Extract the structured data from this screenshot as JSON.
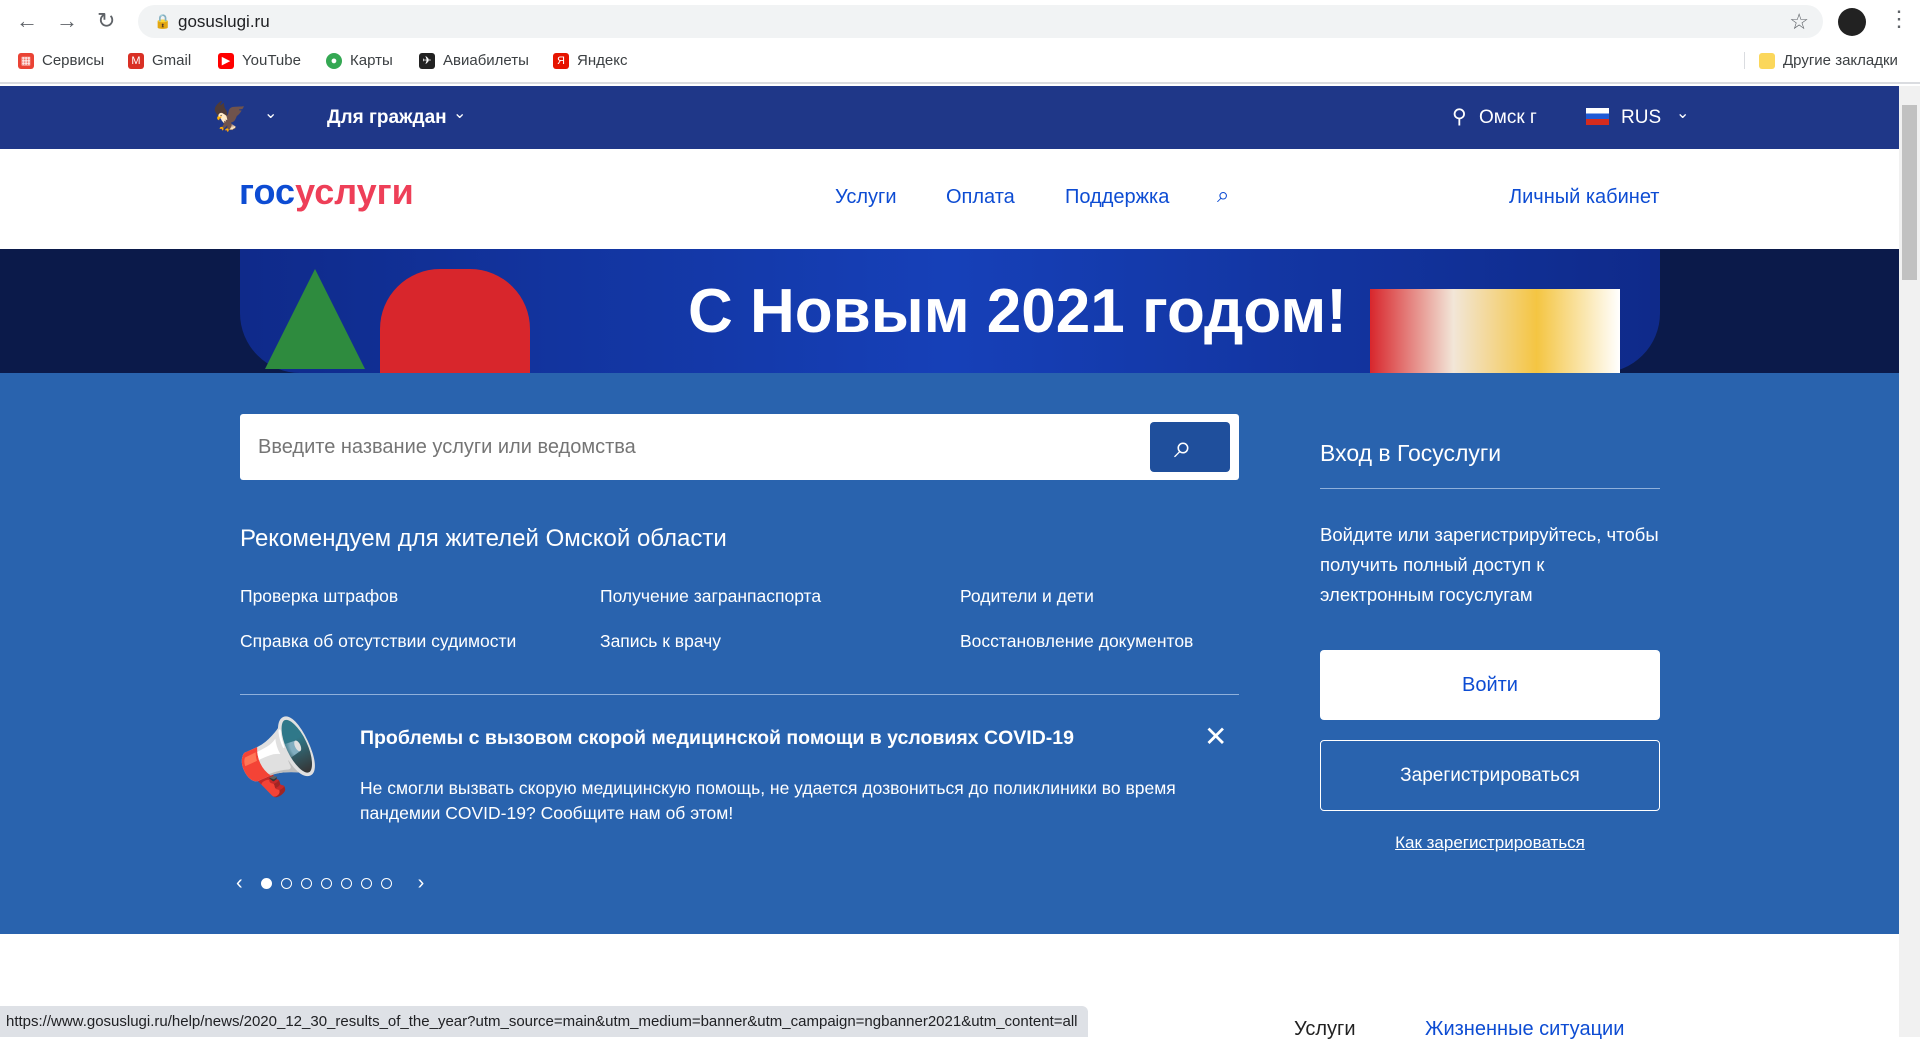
{
  "browser": {
    "url": "gosuslugi.ru",
    "bookmarks": [
      {
        "label": "Сервисы",
        "color": "#ea4335"
      },
      {
        "label": "Gmail",
        "color": "#d93025"
      },
      {
        "label": "YouTube",
        "color": "#ff0000"
      },
      {
        "label": "Карты",
        "color": "#34a853"
      },
      {
        "label": "Авиабилеты",
        "color": "#222222"
      },
      {
        "label": "Яндекс",
        "color": "#e61400"
      }
    ],
    "other_bookmarks": "Другие закладки",
    "status_url": "https://www.gosuslugi.ru/help/news/2020_12_30_results_of_the_year?utm_source=main&utm_medium=banner&utm_campaign=ngbanner2021&utm_content=all"
  },
  "topnav": {
    "audience": "Для граждан",
    "city": "Омск г",
    "lang": "RUS"
  },
  "header": {
    "logo_a": "гос",
    "logo_b": "услуги",
    "links": [
      "Услуги",
      "Оплата",
      "Поддержка"
    ],
    "cabinet": "Личный кабинет"
  },
  "banner": {
    "text": "С Новым 2021 годом!"
  },
  "search": {
    "placeholder": "Введите название услуги или ведомства"
  },
  "recommend": {
    "title": "Рекомендуем для жителей Омской области",
    "items": [
      "Проверка штрафов",
      "Получение загранпаспорта",
      "Родители и дети",
      "Справка об отсутствии судимости",
      "Запись к врачу",
      "Восстановление документов"
    ]
  },
  "notice": {
    "title": "Проблемы с вызовом скорой медицинской помощи в условиях COVID-19",
    "text": "Не смогли вызвать скорую медицинскую помощь, не удается дозвониться до поликлиники во время пандемии COVID-19? Сообщите нам об этом!",
    "slides": 7,
    "active_slide": 1
  },
  "login": {
    "title": "Вход в Госуслуги",
    "text": "Войдите или зарегистрируйтесь, чтобы получить полный доступ к электронным госуслугам",
    "login": "Войти",
    "register": "Зарегистрироваться",
    "howto": "Как зарегистрироваться"
  },
  "bottom_tabs": [
    "Услуги",
    "Жизненные ситуации"
  ],
  "colors": {
    "nav": "#1f3788",
    "main": "#2963ae",
    "accent": "#0d4cd3",
    "red": "#ee3f58"
  }
}
